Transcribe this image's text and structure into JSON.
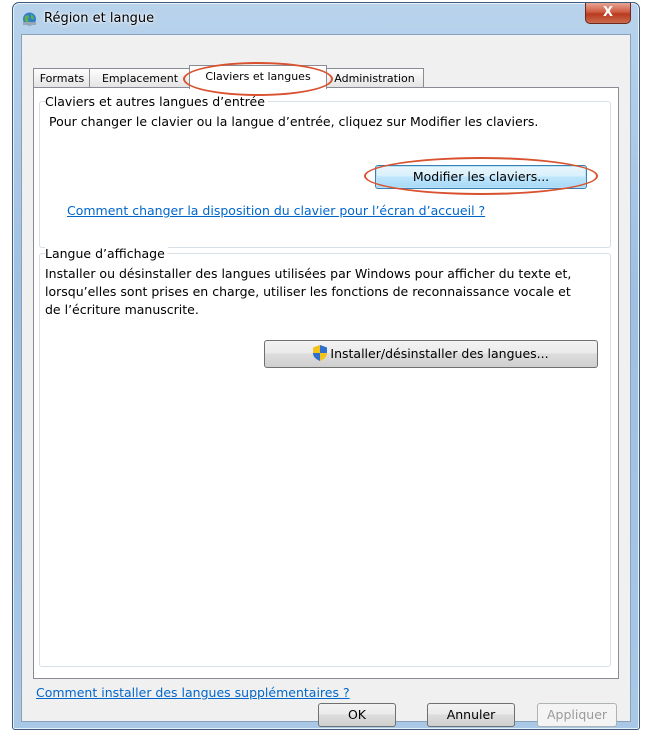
{
  "window": {
    "title": "Région et langue",
    "close_glyph": "X"
  },
  "tabs": [
    {
      "label": "Formats"
    },
    {
      "label": "Emplacement"
    },
    {
      "label": "Claviers et langues",
      "active": true
    },
    {
      "label": "Administration"
    }
  ],
  "keyboards_group": {
    "title": "Claviers et autres langues d’entrée",
    "description": "Pour changer le clavier ou la langue d’entrée, cliquez sur Modifier les claviers.",
    "button_label": "Modifier les claviers...",
    "link": "Comment changer la disposition du clavier pour l’écran d’accueil ?"
  },
  "display_group": {
    "title": "Langue d’affichage",
    "description": "Installer ou désinstaller des langues utilisées par Windows pour afficher du texte et, lorsqu’elles sont prises en charge, utiliser les fonctions de reconnaissance vocale et de l’écriture manuscrite.",
    "button_label": "Installer/désinstaller des langues...",
    "button_icon": "uac-shield-icon"
  },
  "bottom_link": "Comment installer des langues supplémentaires ?",
  "footer": {
    "ok": "OK",
    "cancel": "Annuler",
    "apply": "Appliquer"
  },
  "colors": {
    "highlight_ring": "#d9512f",
    "link": "#0066cc"
  }
}
